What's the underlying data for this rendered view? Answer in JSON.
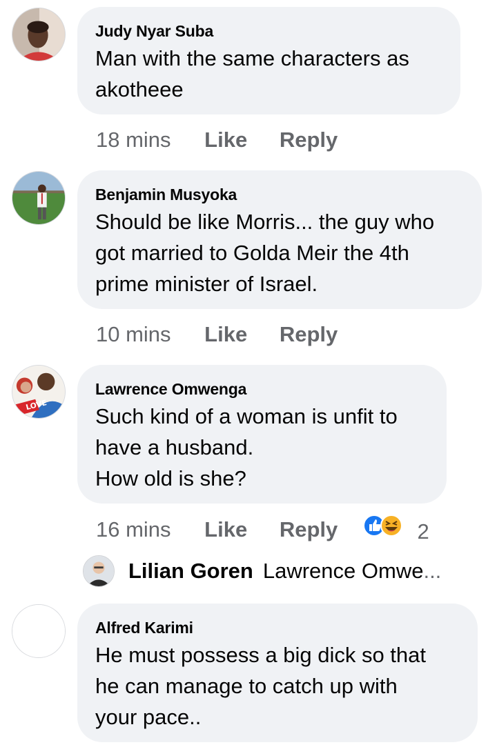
{
  "comments": [
    {
      "author": "Judy Nyar Suba",
      "text": "Man with the same characters as\nakotheee",
      "time": "18 mins",
      "like_label": "Like",
      "reply_label": "Reply"
    },
    {
      "author": "Benjamin Musyoka",
      "text": "Should be like Morris... the guy who\ngot married to Golda Meir the 4th\nprime minister of Israel.",
      "time": "10 mins",
      "like_label": "Like",
      "reply_label": "Reply"
    },
    {
      "author": "Lawrence Omwenga",
      "text": "Such kind of a woman is unfit to\nhave a husband.\nHow old is she?",
      "time": "16 mins",
      "like_label": "Like",
      "reply_label": "Reply",
      "reaction_count": "2",
      "reactions": [
        "like-icon",
        "haha-icon"
      ],
      "avatar_badge": "LOVE"
    },
    {
      "author": "Alfred Karimi",
      "text": "He must possess a big dick so that\nhe can manage to catch up with\nyour pace.."
    }
  ],
  "reply_preview": {
    "author": "Lilian Goren",
    "text": "Lawrence Omwe",
    "ellipsis": "..."
  },
  "colors": {
    "bubble": "#f0f2f5",
    "text": "#050505",
    "secondary": "#65676b",
    "like_blue": "#1877f2",
    "haha_yellow": "#f7b125"
  }
}
